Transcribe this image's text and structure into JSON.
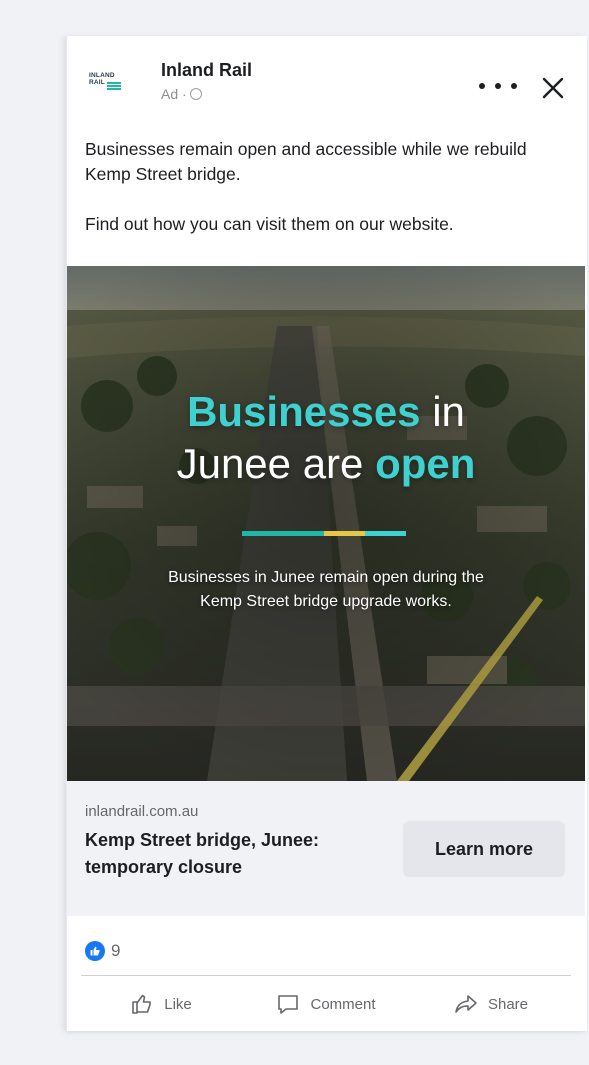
{
  "post": {
    "page_name": "Inland Rail",
    "ad_label": "Ad ·",
    "logo_text_line1": "INLAND",
    "logo_text_line2": "RAIL",
    "text_line1": "Businesses remain open and accessible while we rebuild Kemp Street bridge.",
    "text_line2": "Find out how you can visit them on our website."
  },
  "creative": {
    "headline_word1": "Businesses",
    "headline_word2": " in",
    "headline_word3": "Junee are ",
    "headline_word4": "open",
    "subtext": "Businesses in Junee remain open during the Kemp Street bridge upgrade works.",
    "divider_colors": [
      "#1fb7a6",
      "#1fb7a6",
      "#e8c547",
      "#3fd0d0"
    ],
    "accent_color": "#3fd0d0"
  },
  "link": {
    "domain": "inlandrail.com.au",
    "title": "Kemp Street bridge, Junee: temporary closure",
    "cta_label": "Learn more"
  },
  "engagement": {
    "reaction_count": "9",
    "like_label": "Like",
    "comment_label": "Comment",
    "share_label": "Share"
  },
  "icons": {
    "more": "more-options-icon",
    "close": "close-icon",
    "privacy": "globe-icon",
    "like": "thumbs-up-icon",
    "comment": "comment-bubble-icon",
    "share": "share-arrow-icon"
  }
}
